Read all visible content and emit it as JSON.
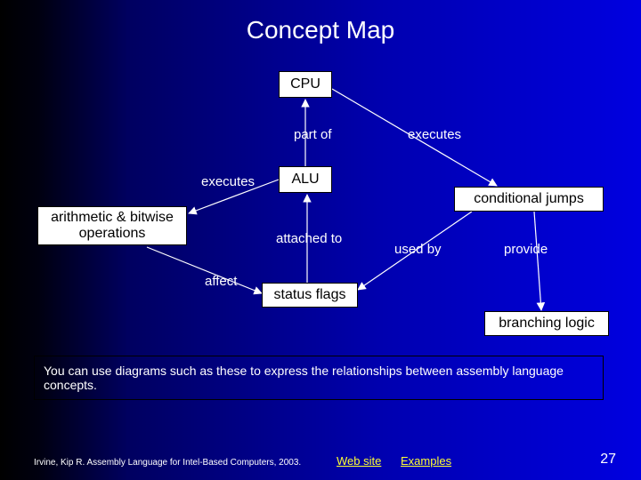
{
  "title": "Concept Map",
  "nodes": {
    "cpu": "CPU",
    "alu": "ALU",
    "abops_line1": "arithmetic & bitwise",
    "abops_line2": "operations",
    "cond": "conditional jumps",
    "status": "status flags",
    "branch": "branching logic"
  },
  "edges": {
    "partof": "part of",
    "executes_right": "executes",
    "executes_left": "executes",
    "attached": "attached to",
    "usedby": "used by",
    "provide": "provide",
    "affect": "affect"
  },
  "note": "You can use diagrams such as these to express the relationships between assembly language concepts.",
  "footer": {
    "citation": "Irvine, Kip R. Assembly Language for Intel-Based Computers, 2003.",
    "web": "Web site",
    "examples": "Examples",
    "page": "27"
  },
  "chart_data": {
    "type": "diagram",
    "nodes": [
      {
        "id": "cpu",
        "label": "CPU"
      },
      {
        "id": "alu",
        "label": "ALU"
      },
      {
        "id": "abops",
        "label": "arithmetic & bitwise operations"
      },
      {
        "id": "cond",
        "label": "conditional jumps"
      },
      {
        "id": "status",
        "label": "status flags"
      },
      {
        "id": "branch",
        "label": "branching logic"
      }
    ],
    "edges": [
      {
        "from": "alu",
        "to": "cpu",
        "label": "part of"
      },
      {
        "from": "cpu",
        "to": "cond",
        "label": "executes",
        "via_point": "right"
      },
      {
        "from": "alu",
        "to": "abops",
        "label": "executes"
      },
      {
        "from": "status",
        "to": "alu",
        "label": "attached to"
      },
      {
        "from": "cond",
        "to": "status",
        "label": "used by"
      },
      {
        "from": "cond",
        "to": "branch",
        "label": "provide"
      },
      {
        "from": "abops",
        "to": "status",
        "label": "affect"
      }
    ]
  }
}
